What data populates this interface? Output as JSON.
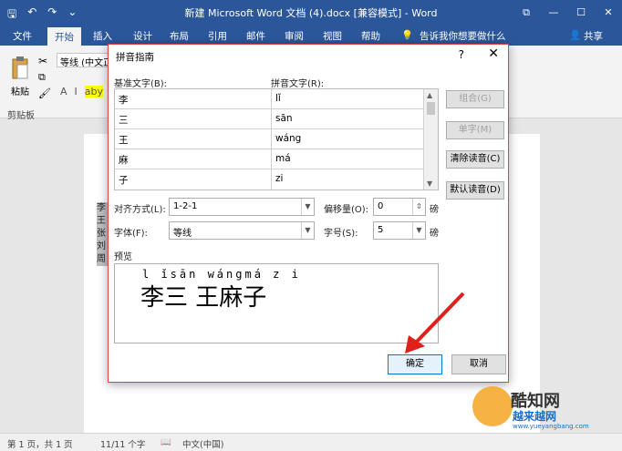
{
  "titlebar": {
    "title": "新建 Microsoft Word 文档 (4).docx [兼容模式] - Word",
    "qat": {
      "save": "🖫",
      "undo": "↶",
      "redo": "↷",
      "customize": "⌄"
    },
    "controls": {
      "restore": "⧉",
      "minimize": "—",
      "maximize": "☐",
      "close": "✕"
    }
  },
  "tabs": [
    "文件",
    "开始",
    "插入",
    "设计",
    "布局",
    "引用",
    "邮件",
    "审阅",
    "视图",
    "帮助"
  ],
  "tell_me": "告诉我你想要做什么",
  "share": "共享",
  "ribbon": {
    "paste": "粘贴",
    "clipboard": "剪贴板",
    "font_box": "等线 (中文正",
    "format_buttons": [
      "A",
      "I",
      "aby",
      "A"
    ]
  },
  "doc": {
    "sel_lines": [
      "李",
      "王",
      "张",
      "刘",
      "周"
    ]
  },
  "status": {
    "page": "第 1 页，共 1 页",
    "words": "11/11 个字",
    "lang": "中文(中国)"
  },
  "dialog": {
    "title": "拼音指南",
    "help": "?",
    "close": "✕",
    "base_label": "基准文字(B):",
    "pinyin_label": "拼音文字(R):",
    "rows": [
      {
        "base": "李",
        "pinyin": "lǐ"
      },
      {
        "base": "三",
        "pinyin": "sān"
      },
      {
        "base": "王",
        "pinyin": "wáng"
      },
      {
        "base": "麻",
        "pinyin": "má"
      },
      {
        "base": "子",
        "pinyin": "zi"
      }
    ],
    "side_buttons": {
      "combine": "组合(G)",
      "single": "单字(M)",
      "clear": "清除读音(C)",
      "default": "默认读音(D)"
    },
    "align_label": "对齐方式(L):",
    "align_value": "1-2-1",
    "offset_label": "偏移量(O):",
    "offset_value": "0",
    "offset_unit": "磅",
    "font_label": "字体(F):",
    "font_value": "等线",
    "size_label": "字号(S):",
    "size_value": "5",
    "size_unit": "磅",
    "preview_label": "预览",
    "preview_pinyin": "l ǐsān wángmá z i",
    "preview_hanzi": "李三 王麻子",
    "ok": "确定",
    "cancel": "取消"
  },
  "watermark": {
    "name": "酷知网",
    "name2": "越来越网",
    "url": "www.yueyangbang.com"
  }
}
